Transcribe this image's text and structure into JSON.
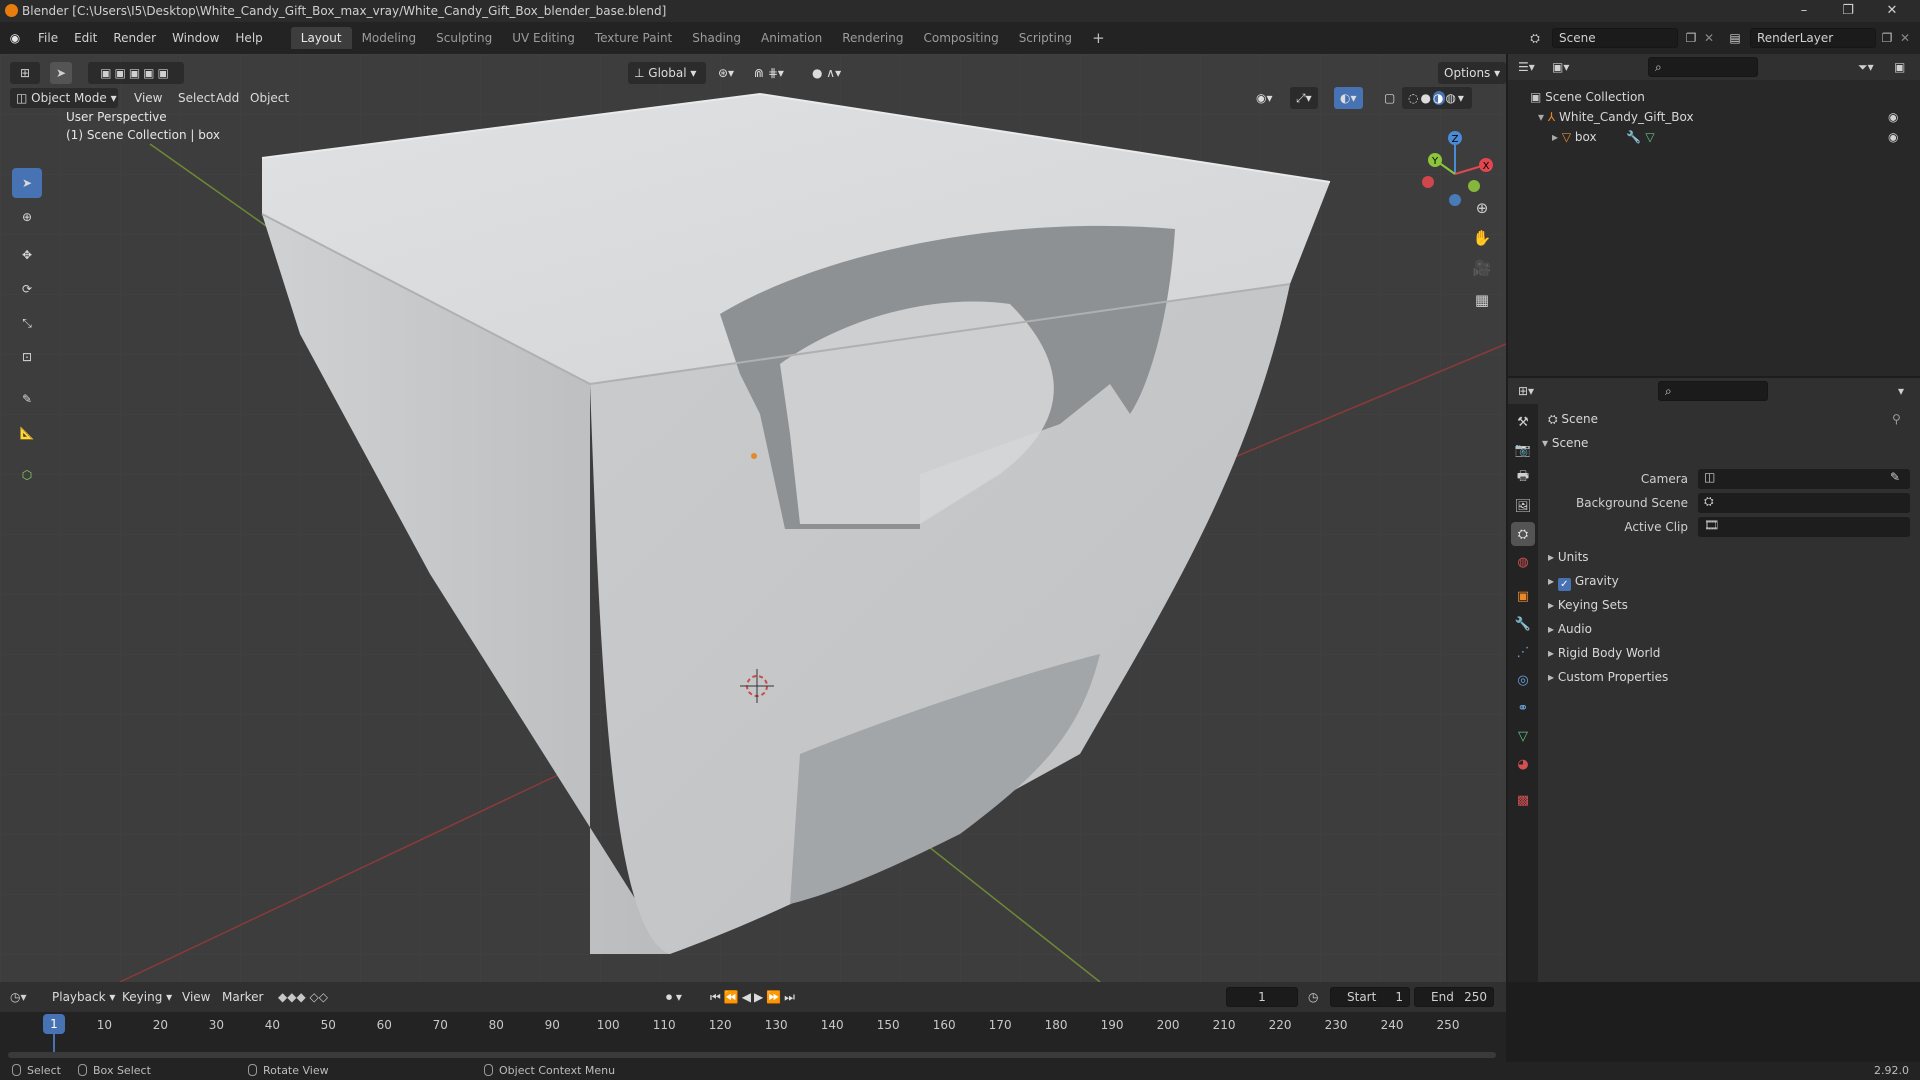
{
  "window": {
    "title": "Blender [C:\\Users\\I5\\Desktop\\White_Candy_Gift_Box_max_vray/White_Candy_Gift_Box_blender_base.blend]",
    "controls": [
      "–",
      "❐",
      "✕"
    ]
  },
  "menu": {
    "items": [
      "File",
      "Edit",
      "Render",
      "Window",
      "Help"
    ],
    "workspaces": [
      "Layout",
      "Modeling",
      "Sculpting",
      "UV Editing",
      "Texture Paint",
      "Shading",
      "Animation",
      "Rendering",
      "Compositing",
      "Scripting"
    ],
    "active_workspace": "Layout",
    "add_tab": "+",
    "scene_name": "Scene",
    "render_layer": "RenderLayer"
  },
  "viewport": {
    "mode": "Object Mode",
    "menus": [
      "View",
      "Select",
      "Add",
      "Object"
    ],
    "transform_orientation": "Global",
    "options": "Options",
    "perspective_label": "User Perspective",
    "collection_label": "(1) Scene Collection | box",
    "gizmo_axes": {
      "x": "X",
      "y": "Y",
      "z": "Z"
    },
    "colors": {
      "x": "#e0474f",
      "y": "#8cc43b",
      "z": "#4b8bd6",
      "grid_x": "#8a3a3a",
      "grid_y": "#5f7c2f",
      "active": "#4772b3"
    }
  },
  "tools": [
    "select-box",
    "cursor",
    "move",
    "rotate",
    "scale",
    "transform",
    "annotate",
    "measure",
    "add-cube"
  ],
  "outliner": {
    "root": "Scene Collection",
    "items": [
      {
        "name": "White_Candy_Gift_Box"
      },
      {
        "name": "box"
      }
    ]
  },
  "properties": {
    "context_title": "Scene",
    "section": "Scene",
    "fields": [
      {
        "label": "Camera"
      },
      {
        "label": "Background Scene"
      },
      {
        "label": "Active Clip"
      }
    ],
    "panels": [
      {
        "label": "Units",
        "checkbox": false
      },
      {
        "label": "Gravity",
        "checkbox": true
      },
      {
        "label": "Keying Sets",
        "checkbox": false
      },
      {
        "label": "Audio",
        "checkbox": false
      },
      {
        "label": "Rigid Body World",
        "checkbox": false
      },
      {
        "label": "Custom Properties",
        "checkbox": false
      }
    ]
  },
  "timeline": {
    "menus": [
      "Playback",
      "Keying",
      "View",
      "Marker"
    ],
    "current_frame": "1",
    "start_label": "Start",
    "start": "1",
    "end_label": "End",
    "end": "250",
    "frame_ticks": [
      "1",
      "10",
      "20",
      "30",
      "40",
      "50",
      "60",
      "70",
      "80",
      "90",
      "100",
      "110",
      "120",
      "130",
      "140",
      "150",
      "160",
      "170",
      "180",
      "190",
      "200",
      "210",
      "220",
      "230",
      "240",
      "250"
    ]
  },
  "status": {
    "select": "Select",
    "box_select": "Box Select",
    "rotate_view": "Rotate View",
    "context_menu": "Object Context Menu",
    "version": "2.92.0"
  }
}
